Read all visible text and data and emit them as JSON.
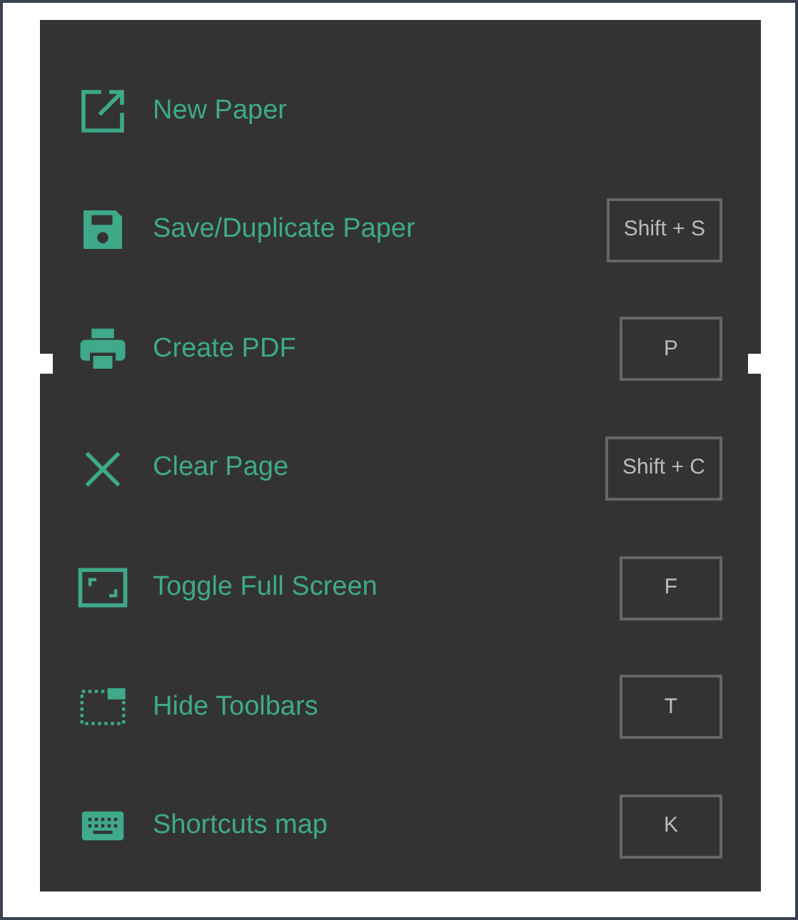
{
  "menu": {
    "items": [
      {
        "label": "New Paper"
      },
      {
        "label": "Save/Duplicate Paper",
        "shortcut": "Shift + S"
      },
      {
        "label": "Create PDF",
        "shortcut": "P"
      },
      {
        "label": "Clear Page",
        "shortcut": "Shift + C"
      },
      {
        "label": "Toggle Full Screen",
        "shortcut": "F"
      },
      {
        "label": "Hide Toolbars",
        "shortcut": "T"
      },
      {
        "label": "Shortcuts map",
        "shortcut": "K"
      }
    ]
  }
}
